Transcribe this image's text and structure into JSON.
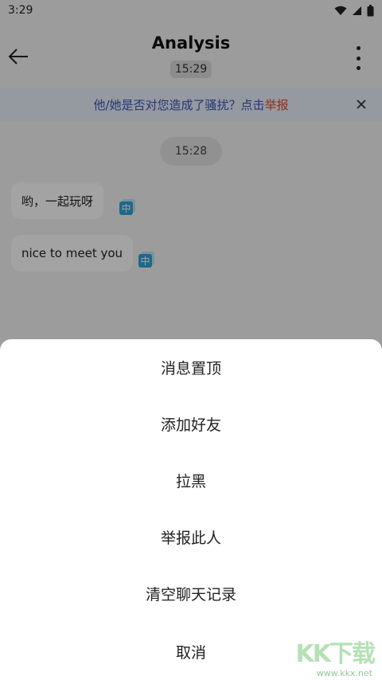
{
  "status_bar": {
    "time": "3:29",
    "icons": [
      "wifi-icon",
      "signal-icon",
      "battery-icon"
    ]
  },
  "header": {
    "title": "Analysis",
    "time": "15:29"
  },
  "banner": {
    "text": "他/她是否对您造成了骚扰？点击",
    "link": "举报"
  },
  "chat": {
    "timestamp": "15:28",
    "messages": [
      {
        "text": "哟，一起玩呀",
        "translate_icon_label": "中"
      },
      {
        "text": "nice to meet you",
        "translate_icon_label": "中"
      }
    ]
  },
  "sheet": {
    "items": [
      "消息置顶",
      "添加好友",
      "拉黑",
      "举报此人",
      "清空聊天记录",
      "取消"
    ]
  },
  "watermark": {
    "logo": "KK下载",
    "url": "www.kkx.net"
  },
  "colors": {
    "banner_text": "#3a55b8",
    "report_link": "#e0462a",
    "translate_badge": "#2fa3d6"
  }
}
